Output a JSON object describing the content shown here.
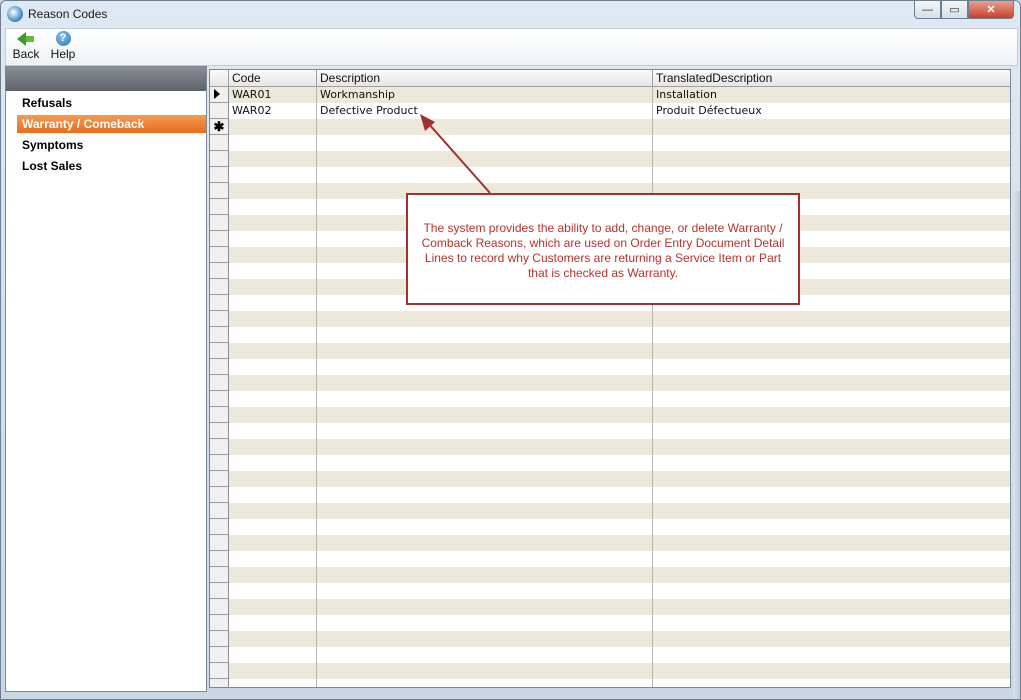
{
  "window": {
    "title": "Reason Codes",
    "controls": {
      "minimize": "—",
      "maximize": "▭",
      "close": "✕"
    }
  },
  "toolbar": {
    "back_label": "Back",
    "help_label": "Help",
    "help_glyph": "?"
  },
  "sidebar": {
    "items": [
      {
        "label": "Refusals",
        "active": false
      },
      {
        "label": "Warranty / Comeback",
        "active": true
      },
      {
        "label": "Symptoms",
        "active": false
      },
      {
        "label": "Lost Sales",
        "active": false
      }
    ]
  },
  "grid": {
    "columns": [
      "Code",
      "Description",
      "TranslatedDescription"
    ],
    "rows": [
      {
        "code": "WAR01",
        "description": "Workmanship",
        "translated": "Installation",
        "current": true
      },
      {
        "code": "WAR02",
        "description": "Defective Product",
        "translated": "Produit Défectueux",
        "current": false
      }
    ],
    "new_row_marker": "✱"
  },
  "callout": {
    "text": "The system provides the ability to add, change, or delete Warranty / Comback Reasons, which are used on Order Entry Document Detail Lines to record why Customers are returning a Service Item or Part that is checked as Warranty."
  },
  "colors": {
    "accent_orange": "#e66f1e",
    "callout_red": "#a23030",
    "row_band": "#ece8da"
  }
}
